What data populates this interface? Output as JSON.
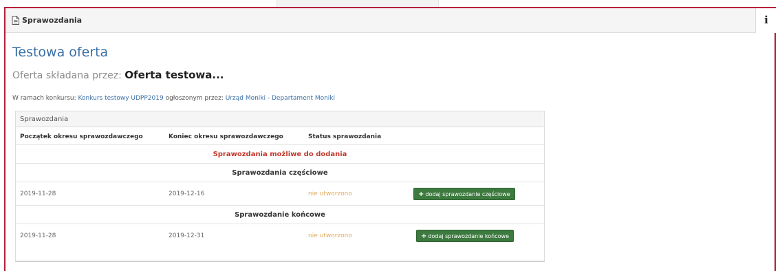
{
  "panel": {
    "title": "Sprawozdania",
    "info_label": "i"
  },
  "offer": {
    "title": "Testowa oferta",
    "submitted_by_prefix": "Oferta składana przez:",
    "submitted_by_name": "Oferta testowa..."
  },
  "competition": {
    "prefix": "W ramach konkursu:",
    "name": "Konkurs testowy UDPP2019",
    "announced_by": "ogłoszonym przez:",
    "organizer": "Urząd Moniki - Departament Moniki"
  },
  "reports": {
    "heading": "Sprawozdania",
    "columns": [
      "Początek okresu sprawozdawczego",
      "Koniec okresu sprawozdawczego",
      "Status sprawozdania"
    ],
    "available_notice": "Sprawozdania możliwe do dodania",
    "partial": {
      "section_title": "Sprawozdania częściowe",
      "start": "2019-11-28",
      "end": "2019-12-16",
      "status": "nie utworzono",
      "button_label": "dodaj sprawozdanie częściowe"
    },
    "final": {
      "section_title": "Sprawozdanie końcowe",
      "start": "2019-11-28",
      "end": "2019-12-31",
      "status": "nie utworzono",
      "button_label": "dodaj sprawozdanie końcowe"
    }
  },
  "colors": {
    "accent_border": "#b51f3b",
    "link": "#3a6fa6",
    "notice": "#c0392b",
    "status_pending": "#e0a960",
    "button": "#3d7a3f"
  },
  "icons": {
    "panel": "document-icon",
    "info": "info-icon",
    "add": "plus-icon"
  }
}
